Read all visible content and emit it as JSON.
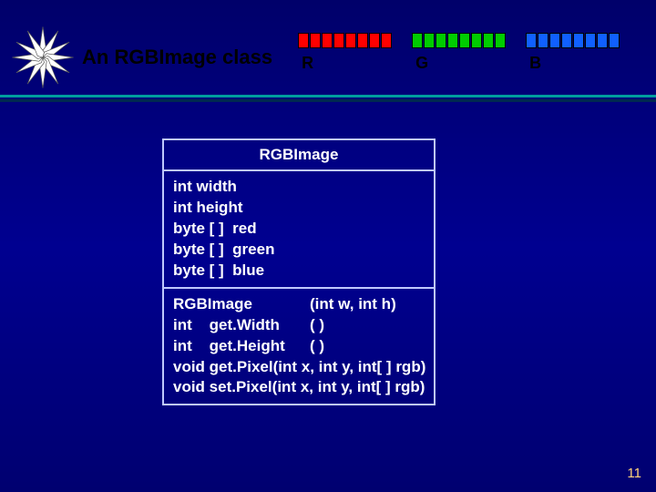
{
  "header": {
    "title": "An RGBImage class",
    "strips": [
      {
        "label": "R",
        "color": "#ff0000"
      },
      {
        "label": "G",
        "color": "#00cc00"
      },
      {
        "label": "B",
        "color": "#1060ff"
      }
    ],
    "cells_per_strip": 8
  },
  "uml": {
    "name": "RGBImage",
    "attributes": [
      "int width",
      "int height",
      "byte [ ]  red",
      "byte [ ]  green",
      "byte [ ]  blue"
    ],
    "operations": [
      {
        "ret": "RGBImage",
        "args": "(int w, int h)"
      },
      {
        "ret": "int    get.Width",
        "args": "( )"
      },
      {
        "ret": "int    get.Height",
        "args": "( )"
      },
      {
        "ret": "void get.Pixel",
        "args": "(int x, int y, int[ ] rgb)"
      },
      {
        "ret": "void set.Pixel",
        "args": "(int x, int y, int[ ] rgb)"
      }
    ]
  },
  "page_number": "11",
  "colors": {
    "star_fill": "#ffffff",
    "star_stroke": "#3a3a3a"
  }
}
